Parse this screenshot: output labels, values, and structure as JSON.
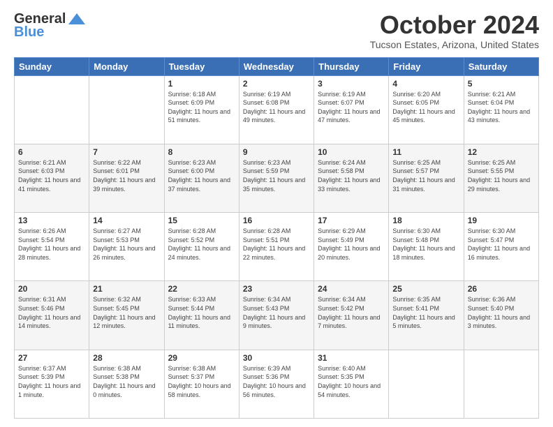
{
  "header": {
    "logo_general": "General",
    "logo_blue": "Blue",
    "title": "October 2024",
    "location": "Tucson Estates, Arizona, United States"
  },
  "weekdays": [
    "Sunday",
    "Monday",
    "Tuesday",
    "Wednesday",
    "Thursday",
    "Friday",
    "Saturday"
  ],
  "weeks": [
    [
      {
        "day": "",
        "sunrise": "",
        "sunset": "",
        "daylight": ""
      },
      {
        "day": "",
        "sunrise": "",
        "sunset": "",
        "daylight": ""
      },
      {
        "day": "1",
        "sunrise": "Sunrise: 6:18 AM",
        "sunset": "Sunset: 6:09 PM",
        "daylight": "Daylight: 11 hours and 51 minutes."
      },
      {
        "day": "2",
        "sunrise": "Sunrise: 6:19 AM",
        "sunset": "Sunset: 6:08 PM",
        "daylight": "Daylight: 11 hours and 49 minutes."
      },
      {
        "day": "3",
        "sunrise": "Sunrise: 6:19 AM",
        "sunset": "Sunset: 6:07 PM",
        "daylight": "Daylight: 11 hours and 47 minutes."
      },
      {
        "day": "4",
        "sunrise": "Sunrise: 6:20 AM",
        "sunset": "Sunset: 6:05 PM",
        "daylight": "Daylight: 11 hours and 45 minutes."
      },
      {
        "day": "5",
        "sunrise": "Sunrise: 6:21 AM",
        "sunset": "Sunset: 6:04 PM",
        "daylight": "Daylight: 11 hours and 43 minutes."
      }
    ],
    [
      {
        "day": "6",
        "sunrise": "Sunrise: 6:21 AM",
        "sunset": "Sunset: 6:03 PM",
        "daylight": "Daylight: 11 hours and 41 minutes."
      },
      {
        "day": "7",
        "sunrise": "Sunrise: 6:22 AM",
        "sunset": "Sunset: 6:01 PM",
        "daylight": "Daylight: 11 hours and 39 minutes."
      },
      {
        "day": "8",
        "sunrise": "Sunrise: 6:23 AM",
        "sunset": "Sunset: 6:00 PM",
        "daylight": "Daylight: 11 hours and 37 minutes."
      },
      {
        "day": "9",
        "sunrise": "Sunrise: 6:23 AM",
        "sunset": "Sunset: 5:59 PM",
        "daylight": "Daylight: 11 hours and 35 minutes."
      },
      {
        "day": "10",
        "sunrise": "Sunrise: 6:24 AM",
        "sunset": "Sunset: 5:58 PM",
        "daylight": "Daylight: 11 hours and 33 minutes."
      },
      {
        "day": "11",
        "sunrise": "Sunrise: 6:25 AM",
        "sunset": "Sunset: 5:57 PM",
        "daylight": "Daylight: 11 hours and 31 minutes."
      },
      {
        "day": "12",
        "sunrise": "Sunrise: 6:25 AM",
        "sunset": "Sunset: 5:55 PM",
        "daylight": "Daylight: 11 hours and 29 minutes."
      }
    ],
    [
      {
        "day": "13",
        "sunrise": "Sunrise: 6:26 AM",
        "sunset": "Sunset: 5:54 PM",
        "daylight": "Daylight: 11 hours and 28 minutes."
      },
      {
        "day": "14",
        "sunrise": "Sunrise: 6:27 AM",
        "sunset": "Sunset: 5:53 PM",
        "daylight": "Daylight: 11 hours and 26 minutes."
      },
      {
        "day": "15",
        "sunrise": "Sunrise: 6:28 AM",
        "sunset": "Sunset: 5:52 PM",
        "daylight": "Daylight: 11 hours and 24 minutes."
      },
      {
        "day": "16",
        "sunrise": "Sunrise: 6:28 AM",
        "sunset": "Sunset: 5:51 PM",
        "daylight": "Daylight: 11 hours and 22 minutes."
      },
      {
        "day": "17",
        "sunrise": "Sunrise: 6:29 AM",
        "sunset": "Sunset: 5:49 PM",
        "daylight": "Daylight: 11 hours and 20 minutes."
      },
      {
        "day": "18",
        "sunrise": "Sunrise: 6:30 AM",
        "sunset": "Sunset: 5:48 PM",
        "daylight": "Daylight: 11 hours and 18 minutes."
      },
      {
        "day": "19",
        "sunrise": "Sunrise: 6:30 AM",
        "sunset": "Sunset: 5:47 PM",
        "daylight": "Daylight: 11 hours and 16 minutes."
      }
    ],
    [
      {
        "day": "20",
        "sunrise": "Sunrise: 6:31 AM",
        "sunset": "Sunset: 5:46 PM",
        "daylight": "Daylight: 11 hours and 14 minutes."
      },
      {
        "day": "21",
        "sunrise": "Sunrise: 6:32 AM",
        "sunset": "Sunset: 5:45 PM",
        "daylight": "Daylight: 11 hours and 12 minutes."
      },
      {
        "day": "22",
        "sunrise": "Sunrise: 6:33 AM",
        "sunset": "Sunset: 5:44 PM",
        "daylight": "Daylight: 11 hours and 11 minutes."
      },
      {
        "day": "23",
        "sunrise": "Sunrise: 6:34 AM",
        "sunset": "Sunset: 5:43 PM",
        "daylight": "Daylight: 11 hours and 9 minutes."
      },
      {
        "day": "24",
        "sunrise": "Sunrise: 6:34 AM",
        "sunset": "Sunset: 5:42 PM",
        "daylight": "Daylight: 11 hours and 7 minutes."
      },
      {
        "day": "25",
        "sunrise": "Sunrise: 6:35 AM",
        "sunset": "Sunset: 5:41 PM",
        "daylight": "Daylight: 11 hours and 5 minutes."
      },
      {
        "day": "26",
        "sunrise": "Sunrise: 6:36 AM",
        "sunset": "Sunset: 5:40 PM",
        "daylight": "Daylight: 11 hours and 3 minutes."
      }
    ],
    [
      {
        "day": "27",
        "sunrise": "Sunrise: 6:37 AM",
        "sunset": "Sunset: 5:39 PM",
        "daylight": "Daylight: 11 hours and 1 minute."
      },
      {
        "day": "28",
        "sunrise": "Sunrise: 6:38 AM",
        "sunset": "Sunset: 5:38 PM",
        "daylight": "Daylight: 11 hours and 0 minutes."
      },
      {
        "day": "29",
        "sunrise": "Sunrise: 6:38 AM",
        "sunset": "Sunset: 5:37 PM",
        "daylight": "Daylight: 10 hours and 58 minutes."
      },
      {
        "day": "30",
        "sunrise": "Sunrise: 6:39 AM",
        "sunset": "Sunset: 5:36 PM",
        "daylight": "Daylight: 10 hours and 56 minutes."
      },
      {
        "day": "31",
        "sunrise": "Sunrise: 6:40 AM",
        "sunset": "Sunset: 5:35 PM",
        "daylight": "Daylight: 10 hours and 54 minutes."
      },
      {
        "day": "",
        "sunrise": "",
        "sunset": "",
        "daylight": ""
      },
      {
        "day": "",
        "sunrise": "",
        "sunset": "",
        "daylight": ""
      }
    ]
  ]
}
